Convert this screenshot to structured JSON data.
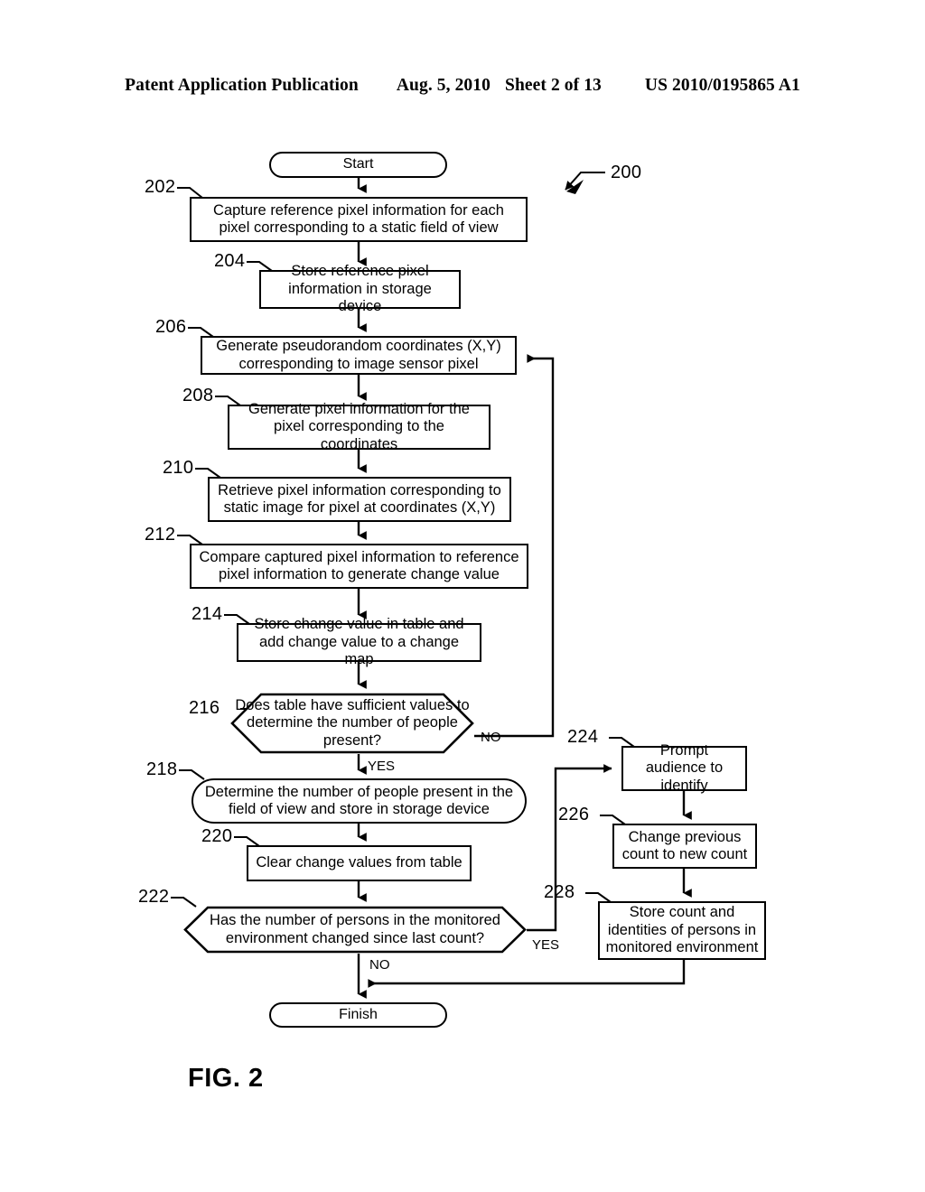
{
  "header": {
    "publication": "Patent Application Publication",
    "date": "Aug. 5, 2010",
    "sheet": "Sheet 2 of 13",
    "number": "US 2010/0195865 A1"
  },
  "figure": {
    "caption": "FIG. 2",
    "diagram_ref": "200"
  },
  "nodes": {
    "start": {
      "ref": "",
      "text": "Start"
    },
    "s202": {
      "ref": "202",
      "text": "Capture reference pixel information for each pixel corresponding to a static field of view"
    },
    "s204": {
      "ref": "204",
      "text": "Store reference pixel information in storage device"
    },
    "s206": {
      "ref": "206",
      "text": "Generate pseudorandom coordinates (X,Y) corresponding to image sensor pixel"
    },
    "s208": {
      "ref": "208",
      "text": "Generate pixel information for the pixel corresponding to the coordinates"
    },
    "s210": {
      "ref": "210",
      "text": "Retrieve pixel information corresponding to static image for pixel at coordinates (X,Y)"
    },
    "s212": {
      "ref": "212",
      "text": "Compare captured pixel information to reference pixel information to generate change value"
    },
    "s214": {
      "ref": "214",
      "text": "Store change value in table and add change value to a change map"
    },
    "s216": {
      "ref": "216",
      "text": "Does table have sufficient values to determine the number of people present?"
    },
    "s218": {
      "ref": "218",
      "text": "Determine the number of people present in the field of view and store in storage device"
    },
    "s220": {
      "ref": "220",
      "text": "Clear change values from table"
    },
    "s222": {
      "ref": "222",
      "text": "Has the number of persons in the monitored environment changed since last count?"
    },
    "s224": {
      "ref": "224",
      "text": "Prompt audience to identify"
    },
    "s226": {
      "ref": "226",
      "text": "Change previous count to new count"
    },
    "s228": {
      "ref": "228",
      "text": "Store count and identities of persons in monitored environment"
    },
    "finish": {
      "ref": "",
      "text": "Finish"
    }
  },
  "branches": {
    "b216_no": "NO",
    "b216_yes": "YES",
    "b222_yes": "YES",
    "b222_no": "NO"
  },
  "colors": {
    "ink": "#000000",
    "paper": "#ffffff"
  }
}
